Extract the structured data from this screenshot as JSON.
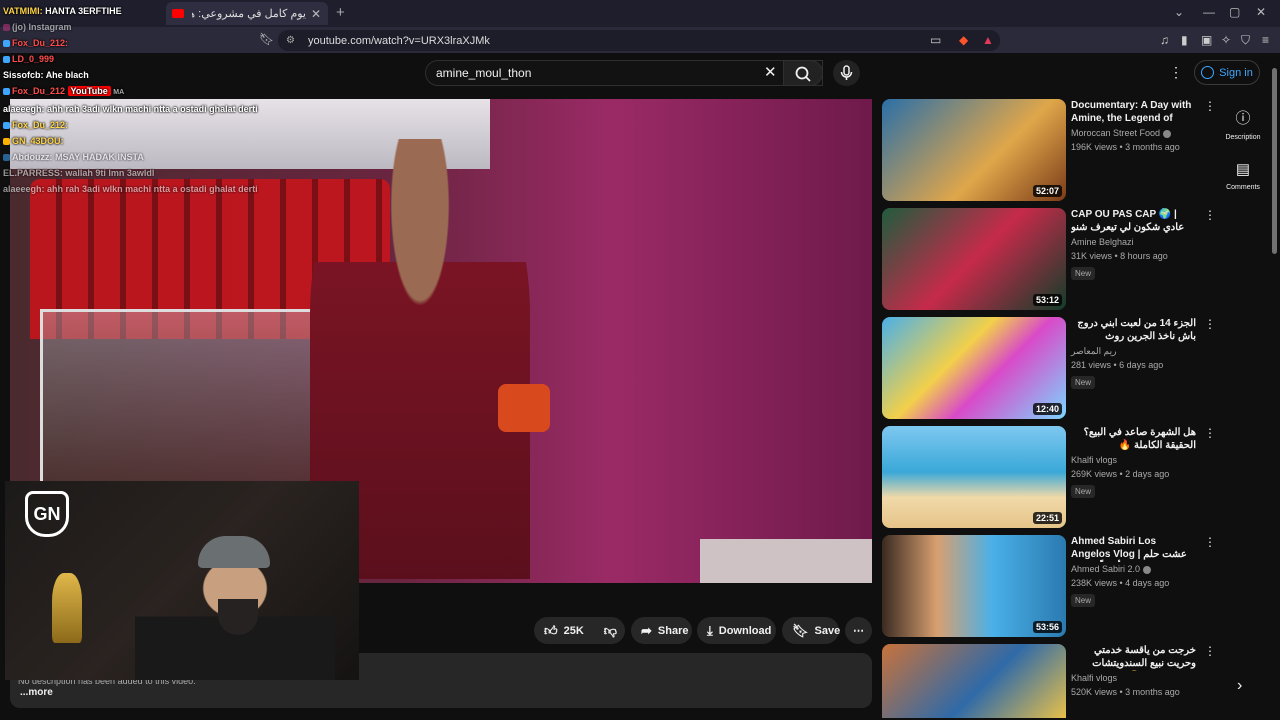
{
  "browser": {
    "tab_title": "يوم كامل في مشروعي: هكذا كيدور",
    "url": "youtube.com/watch?v=URX3lraXJMk",
    "new_tab": "+"
  },
  "youtube": {
    "logo_text": "YouTube",
    "region": "MA",
    "search_value": "amine_moul_thon",
    "sign_in": "Sign in"
  },
  "chat": [
    {
      "user": "VATMIMI:",
      "msg": "HANTA 3ERFTIHE"
    },
    {
      "user": "",
      "msg": "(jo) Instagram"
    },
    {
      "user": "",
      "msg": "Fox_Du_212:"
    },
    {
      "user": "",
      "msg": "LD_0_999"
    },
    {
      "user": "Sissofcb:",
      "msg": "Ahe blach"
    },
    {
      "user": "",
      "msg": "Fox_Du_212"
    },
    {
      "user": "alaeeegh:",
      "msg": "ahh rah 3adi wlkn machi ntta a ostadi ghalat derti"
    },
    {
      "user": "",
      "msg": "Fox_Du_212:"
    },
    {
      "user": "",
      "msg": "GN_43DOU:"
    },
    {
      "user": "",
      "msg": "Abdouzz: MSAY HADAK INSTA"
    },
    {
      "user": "EL.PARRESS:",
      "msg": "wallah 9ti lmn 3awldl"
    },
    {
      "user": "alaeeegh:",
      "msg": "ahh rah 3adi wlkn machi ntta a ostadi ghalat derti"
    }
  ],
  "actions": {
    "likes": "25K",
    "share": "Share",
    "download": "Download",
    "save": "Save"
  },
  "description": {
    "text": "No description has been added to this video.",
    "more": "...more"
  },
  "side_panel": {
    "description": "Description",
    "comments": "Comments"
  },
  "recommendations": [
    {
      "title": "Documentary: A Day with Amine, the Legend of Tuna ...",
      "channel": "Moroccan Street Food",
      "verified": true,
      "meta": "196K views • 3 months ago",
      "duration": "52:07",
      "badge": "",
      "rtl": false
    },
    {
      "title": "CAP OU PAS CAP 🌍 | عادي شكون لي تيعرف شنو كيدير مع الكورة",
      "channel": "Amine Belghazi",
      "verified": false,
      "meta": "31K views • 8 hours ago",
      "duration": "53:12",
      "badge": "New",
      "rtl": false
    },
    {
      "title": "الجزء 14 من لعبت ابني دروج باش ناخذ الجرين روث",
      "channel": "ريم المعاصر",
      "verified": false,
      "meta": "281 views • 6 days ago",
      "duration": "12:40",
      "badge": "New",
      "rtl": true
    },
    {
      "title": "هل الشهرة صاعد في البيع؟ الحقيقة الكاملة 🔥",
      "channel": "Khalfi vlogs",
      "verified": false,
      "meta": "269K views • 2 days ago",
      "duration": "22:51",
      "badge": "New",
      "rtl": true
    },
    {
      "title": "Ahmed Sabiri Los Angelos Vlog | عشت حلم الطفولة.. أخيراً وصلت",
      "channel": "Ahmed Sabiri 2.0",
      "verified": true,
      "meta": "238K views • 4 days ago",
      "duration": "53:56",
      "badge": "New",
      "rtl": false
    },
    {
      "title": "خرجت من ياقسة خدمتي وحريت نبيع السندويتشات بحرية صغيرة 😂",
      "channel": "Khalfi vlogs",
      "verified": false,
      "meta": "520K views • 3 months ago",
      "duration": "",
      "badge": "",
      "rtl": true
    }
  ],
  "colors": {
    "accent_blue": "#3ea6ff",
    "youtube_red": "#ff0000",
    "background": "#0f0f0f"
  }
}
